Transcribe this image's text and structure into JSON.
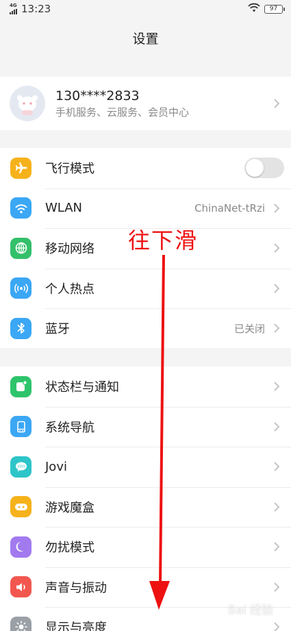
{
  "status_bar": {
    "network": "4G",
    "time": "13:23",
    "battery": "97"
  },
  "header": {
    "title": "设置"
  },
  "profile": {
    "phone": "130****2833",
    "subtitle": "手机服务、云服务、会员中心"
  },
  "groups": [
    {
      "items": [
        {
          "label": "飞行模式",
          "icon": "airplane-icon",
          "icon_color": "#f6b21a",
          "control": "toggle",
          "toggle_on": false
        },
        {
          "label": "WLAN",
          "icon": "wifi-icon",
          "icon_color": "#3ba7f5",
          "value": "ChinaNet-tRzi"
        },
        {
          "label": "移动网络",
          "icon": "globe-icon",
          "icon_color": "#33c06a"
        },
        {
          "label": "个人热点",
          "icon": "hotspot-icon",
          "icon_color": "#3ba7f5"
        },
        {
          "label": "蓝牙",
          "icon": "bluetooth-icon",
          "icon_color": "#3ba7f5",
          "value": "已关闭"
        }
      ]
    },
    {
      "items": [
        {
          "label": "状态栏与通知",
          "icon": "notification-icon",
          "icon_color": "#2ec46b"
        },
        {
          "label": "系统导航",
          "icon": "navigation-icon",
          "icon_color": "#3ba7f5"
        },
        {
          "label": "Jovi",
          "icon": "jovi-icon",
          "icon_color": "#2ec5c8"
        },
        {
          "label": "游戏魔盒",
          "icon": "gamepad-icon",
          "icon_color": "#f6b21a"
        },
        {
          "label": "勿扰模式",
          "icon": "moon-icon",
          "icon_color": "#a27af0"
        },
        {
          "label": "声音与振动",
          "icon": "speaker-icon",
          "icon_color": "#f2574f"
        },
        {
          "label": "显示与亮度",
          "icon": "brightness-icon",
          "icon_color": "#9aa0a6"
        }
      ]
    }
  ],
  "annotation": {
    "text": "往下滑",
    "color": "#ee1111"
  },
  "watermark": {
    "text": "Bai 经验"
  }
}
